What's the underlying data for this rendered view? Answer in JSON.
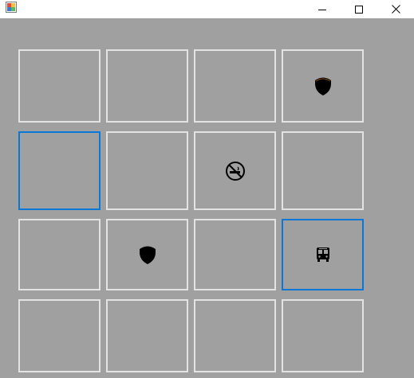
{
  "window": {
    "title": "",
    "controls": [
      "minimize",
      "maximize",
      "close"
    ]
  },
  "board": {
    "rows": 4,
    "cols": 4,
    "tiles": [
      [
        {
          "icon": null,
          "selected": false
        },
        {
          "icon": null,
          "selected": false
        },
        {
          "icon": null,
          "selected": false
        },
        {
          "icon": "shield-icon",
          "selected": false
        }
      ],
      [
        {
          "icon": null,
          "selected": true
        },
        {
          "icon": null,
          "selected": false
        },
        {
          "icon": "no-smoking-icon",
          "selected": false
        },
        {
          "icon": null,
          "selected": false
        }
      ],
      [
        {
          "icon": null,
          "selected": false
        },
        {
          "icon": "shield-icon",
          "selected": false
        },
        {
          "icon": null,
          "selected": false
        },
        {
          "icon": "bus-icon",
          "selected": true
        }
      ],
      [
        {
          "icon": null,
          "selected": false
        },
        {
          "icon": null,
          "selected": false
        },
        {
          "icon": null,
          "selected": false
        },
        {
          "icon": null,
          "selected": false
        }
      ]
    ]
  },
  "colors": {
    "background": "#a0a0a0",
    "tile_border": "#e3e3e3",
    "selected_border": "#0a78d7",
    "titlebar": "#ffffff"
  }
}
